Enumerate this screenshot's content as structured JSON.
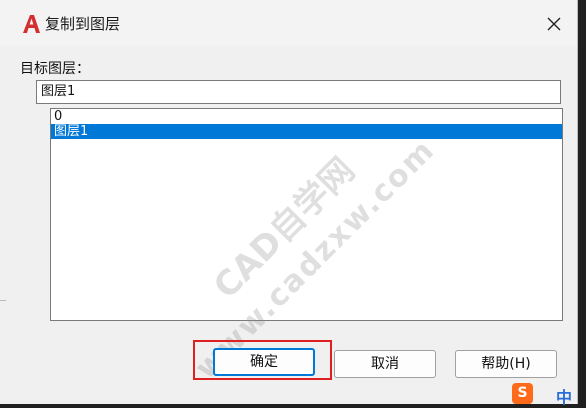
{
  "window": {
    "title": "复制到图层"
  },
  "form": {
    "target_label": "目标图层：",
    "target_value": "图层1"
  },
  "layer_list": {
    "items": [
      {
        "name": "0",
        "selected": false
      },
      {
        "name": "图层1",
        "selected": true
      }
    ]
  },
  "buttons": {
    "ok": "确定",
    "cancel": "取消",
    "help": "帮助(H)"
  },
  "watermark": {
    "line1": "CAD自学网",
    "line2": "www.cadzxw.com"
  },
  "taskbar": {
    "ime_icon": "S",
    "ime_text": "中"
  },
  "colors": {
    "selection": "#0078d7",
    "highlight_box": "#e02020",
    "app_icon": "#d32f2f"
  },
  "icons": {
    "app": "autocad-icon",
    "close": "close-icon"
  }
}
